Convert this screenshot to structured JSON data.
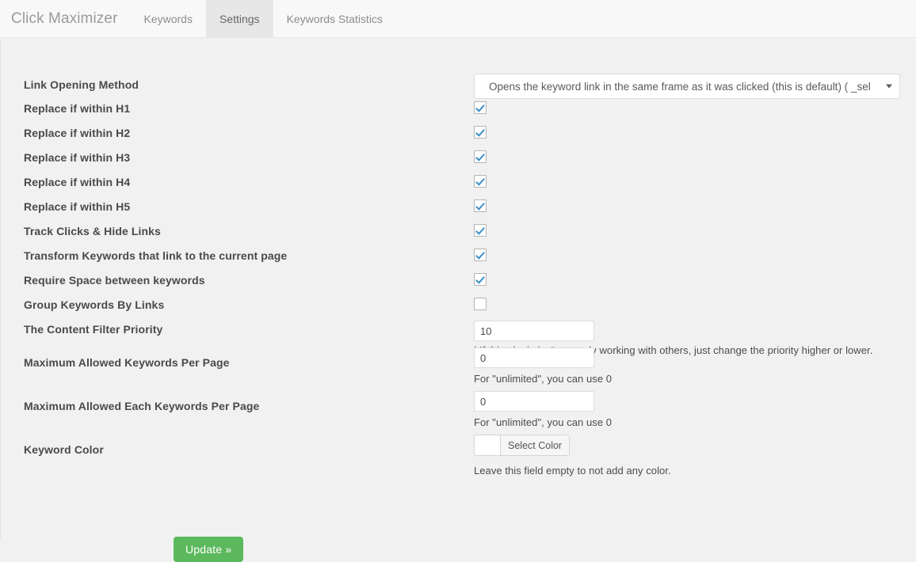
{
  "navbar": {
    "brand": "Click Maximizer",
    "tabs": [
      {
        "label": "Keywords",
        "active": false
      },
      {
        "label": "Settings",
        "active": true
      },
      {
        "label": "Keywords Statistics",
        "active": false
      }
    ]
  },
  "form": {
    "link_opening_method": {
      "label": "Link Opening Method",
      "selected": "Opens the keyword link in the same frame as it was clicked (this is default) ( _sel"
    },
    "replace_h1": {
      "label": "Replace if within H1",
      "checked": true
    },
    "replace_h2": {
      "label": "Replace if within H2",
      "checked": true
    },
    "replace_h3": {
      "label": "Replace if within H3",
      "checked": true
    },
    "replace_h4": {
      "label": "Replace if within H4",
      "checked": true
    },
    "replace_h5": {
      "label": "Replace if within H5",
      "checked": true
    },
    "track_clicks": {
      "label": "Track Clicks & Hide Links",
      "checked": true
    },
    "transform_keywords": {
      "label": "Transform Keywords that link to the current page",
      "checked": true
    },
    "require_space": {
      "label": "Require Space between keywords",
      "checked": true
    },
    "group_keywords": {
      "label": "Group Keywords By Links",
      "checked": false
    },
    "content_filter_priority": {
      "label": "The Content Filter Priority",
      "value": "10",
      "help": "| If this plugin isn't properly working with others, just change the priority higher or lower."
    },
    "max_keywords_per_page": {
      "label": "Maximum Allowed Keywords Per Page",
      "value": "0",
      "help": "For \"unlimited\", you can use 0"
    },
    "max_each_keywords_per_page": {
      "label": "Maximum Allowed Each Keywords Per Page",
      "value": "0",
      "help": "For \"unlimited\", you can use 0"
    },
    "keyword_color": {
      "label": "Keyword Color",
      "swatch_color": "#fefefe",
      "button_label": "Select Color",
      "help": "Leave this field empty to not add any color."
    },
    "submit_label": "Update »"
  },
  "colors": {
    "accent_green": "#5cb85c",
    "checkbox_check": "#3a8fc8",
    "page_background": "#f1f1f1",
    "navbar_background": "#f8f8f8",
    "active_tab_background": "#e7e7e7"
  }
}
